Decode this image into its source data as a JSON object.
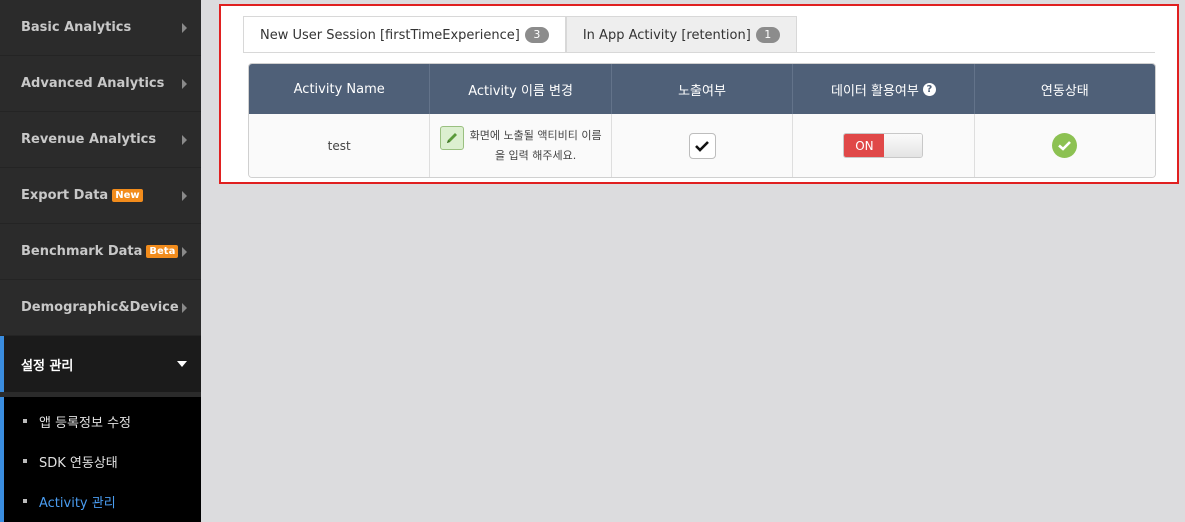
{
  "sidebar": {
    "items": [
      {
        "label": "Basic Analytics",
        "badge": ""
      },
      {
        "label": "Advanced Analytics",
        "badge": ""
      },
      {
        "label": "Revenue Analytics",
        "badge": ""
      },
      {
        "label": "Export Data",
        "badge": "New"
      },
      {
        "label": "Benchmark Data",
        "badge": "Beta"
      },
      {
        "label": "Demographic&Device",
        "badge": ""
      }
    ],
    "active": {
      "label": "설정 관리"
    },
    "submenu": [
      {
        "label": "앱 등록정보 수정"
      },
      {
        "label": "SDK 연동상태"
      },
      {
        "label": "Activity 관리"
      }
    ]
  },
  "tabs": [
    {
      "label": "New User Session [firstTimeExperience]",
      "count": "3"
    },
    {
      "label": "In App Activity [retention]",
      "count": "1"
    }
  ],
  "table": {
    "headers": [
      "Activity Name",
      "Activity 이름 변경",
      "노출여부",
      "데이터 활용여부",
      "연동상태"
    ],
    "help_icon": "?",
    "row": {
      "name": "test",
      "hint_line1": "화면에 노출될 액티비티 이름",
      "hint_line2": "을 입력 해주세요.",
      "exposed": true,
      "toggle_label": "ON",
      "status": "connected"
    }
  },
  "colors": {
    "accent": "#3a8de0",
    "header": "#4f6078",
    "toggle_on": "#e04848",
    "status_ok": "#8cc152",
    "highlight_border": "#e02020"
  }
}
